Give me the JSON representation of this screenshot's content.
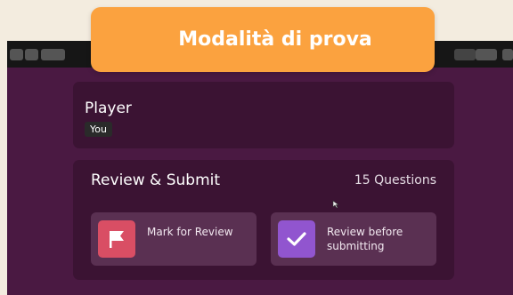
{
  "banner": {
    "title": "Modalità di prova"
  },
  "player": {
    "title": "Player",
    "badge": "You"
  },
  "review": {
    "title": "Review & Submit",
    "questions_count": "15 Questions",
    "options": [
      {
        "label": "Mark for Review",
        "icon": "flag-icon",
        "color": "#d94e64"
      },
      {
        "label": "Review before submitting",
        "icon": "checkmark-icon",
        "color": "#9155cf"
      }
    ]
  },
  "colors": {
    "background": "#4a1942",
    "banner": "#fba23f",
    "card": "#3b1333"
  }
}
